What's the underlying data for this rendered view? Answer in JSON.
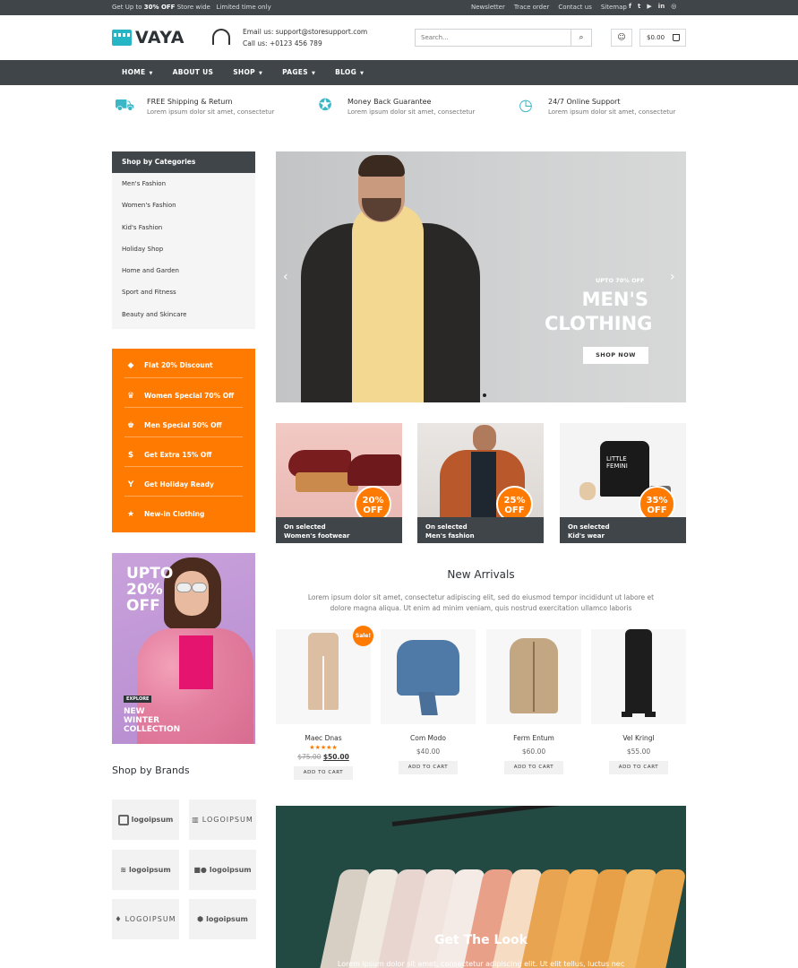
{
  "topbar": {
    "promo_pre": "Get Up to ",
    "promo_bold": "30% OFF",
    "promo_post": " Store wide",
    "promo_extra": "Limited time only",
    "links": [
      "Newsletter",
      "Trace order",
      "Contact us",
      "Sitemap"
    ],
    "social_icons": [
      "facebook-icon",
      "twitter-icon",
      "youtube-icon",
      "linkedin-icon",
      "instagram-icon"
    ]
  },
  "header": {
    "logo": "VAYA",
    "email_label": "Email us: support@storesupport.com",
    "phone_label": "Call us: +0123 456 789",
    "search_placeholder": "Search...",
    "cart_total": "$0.00"
  },
  "nav": [
    {
      "label": "HOME",
      "caret": "▼"
    },
    {
      "label": "ABOUT US",
      "caret": ""
    },
    {
      "label": "SHOP",
      "caret": "▼"
    },
    {
      "label": "PAGES",
      "caret": "▼"
    },
    {
      "label": "BLOG",
      "caret": "▼"
    }
  ],
  "features": [
    {
      "title": "FREE Shipping & Return",
      "sub": "Lorem ipsum dolor sit amet, consectetur",
      "icon": "truck-icon"
    },
    {
      "title": "Money Back Guarantee",
      "sub": "Lorem ipsum dolor sit amet, consectetur",
      "icon": "badge-icon"
    },
    {
      "title": "24/7 Online Support",
      "sub": "Lorem ipsum dolor sit amet, consectetur",
      "icon": "clock-24-icon"
    }
  ],
  "categories": {
    "title": "Shop by Categories",
    "items": [
      "Men's Fashion",
      "Women's Fashion",
      "Kid's Fashion",
      "Holiday Shop",
      "Home and Garden",
      "Sport and Fitness",
      "Beauty and Skincare"
    ]
  },
  "offers": [
    {
      "label": "Flat 20% Discount",
      "icon": "tag-icon",
      "glyph": "◆"
    },
    {
      "label": "Women Special 70% Off",
      "icon": "crown-icon",
      "glyph": "♛"
    },
    {
      "label": "Men Special 50% Off",
      "icon": "crown-icon",
      "glyph": "♚"
    },
    {
      "label": "Get Extra 15% Off",
      "icon": "dollar-icon",
      "glyph": "$"
    },
    {
      "label": "Get Holiday Ready",
      "icon": "cocktail-icon",
      "glyph": "Y"
    },
    {
      "label": "New-in Clothing",
      "icon": "star-icon",
      "glyph": "★"
    }
  ],
  "promo_box": {
    "line1": "UPTO",
    "line2": "20%",
    "line3": "OFF",
    "explore": "EXPLORE",
    "new1": "NEW",
    "new2": "WINTER",
    "new3": "COLLECTION"
  },
  "brands": {
    "title": "Shop by Brands",
    "items": [
      "logoipsum",
      "LOGOIPSUM",
      "logoipsum",
      "logoipsum",
      "LOGOIPSUM",
      "logoipsum"
    ]
  },
  "hero": {
    "kicker": "UPTO 70% OFF",
    "title1": "MEN'S",
    "title2": "CLOTHING",
    "button": "SHOP NOW",
    "prev": "‹",
    "next": "›"
  },
  "tiles": [
    {
      "pct": "20%",
      "off": "OFF",
      "line1": "On selected",
      "line2": "Women's footwear"
    },
    {
      "pct": "25%",
      "off": "OFF",
      "line1": "On selected",
      "line2": "Men's fashion"
    },
    {
      "pct": "35%",
      "off": "OFF",
      "line1": "On selected",
      "line2": "Kid's wear"
    }
  ],
  "new_arrivals": {
    "title": "New Arrivals",
    "desc": "Lorem ipsum dolor sit amet, consectetur adipiscing elit, sed do eiusmod tempor incididunt ut labore et dolore magna aliqua. Ut enim ad minim veniam, quis nostrud exercitation ullamco laboris",
    "sale_badge": "Sale!",
    "products": [
      {
        "name": "Maec Dnas",
        "stars": "★★★★★",
        "rating": 5,
        "old_price": "$75.00",
        "price": "$50.00",
        "button": "ADD TO CART"
      },
      {
        "name": "Com Modo",
        "price": "$40.00",
        "button": "ADD TO CART"
      },
      {
        "name": "Ferm Entum",
        "price": "$60.00",
        "button": "ADD TO CART"
      },
      {
        "name": "Vel Kringl",
        "price": "$55.00",
        "button": "ADD TO CART"
      }
    ]
  },
  "look": {
    "title": "Get The Look",
    "desc": "Lorem ipsum dolor sit amet, consectetur adipiscing elit. Ut elit tellus, luctus nec"
  },
  "colors": {
    "accent": "#ff7a00",
    "dark": "#3f4549",
    "teal": "#25b5c4"
  }
}
